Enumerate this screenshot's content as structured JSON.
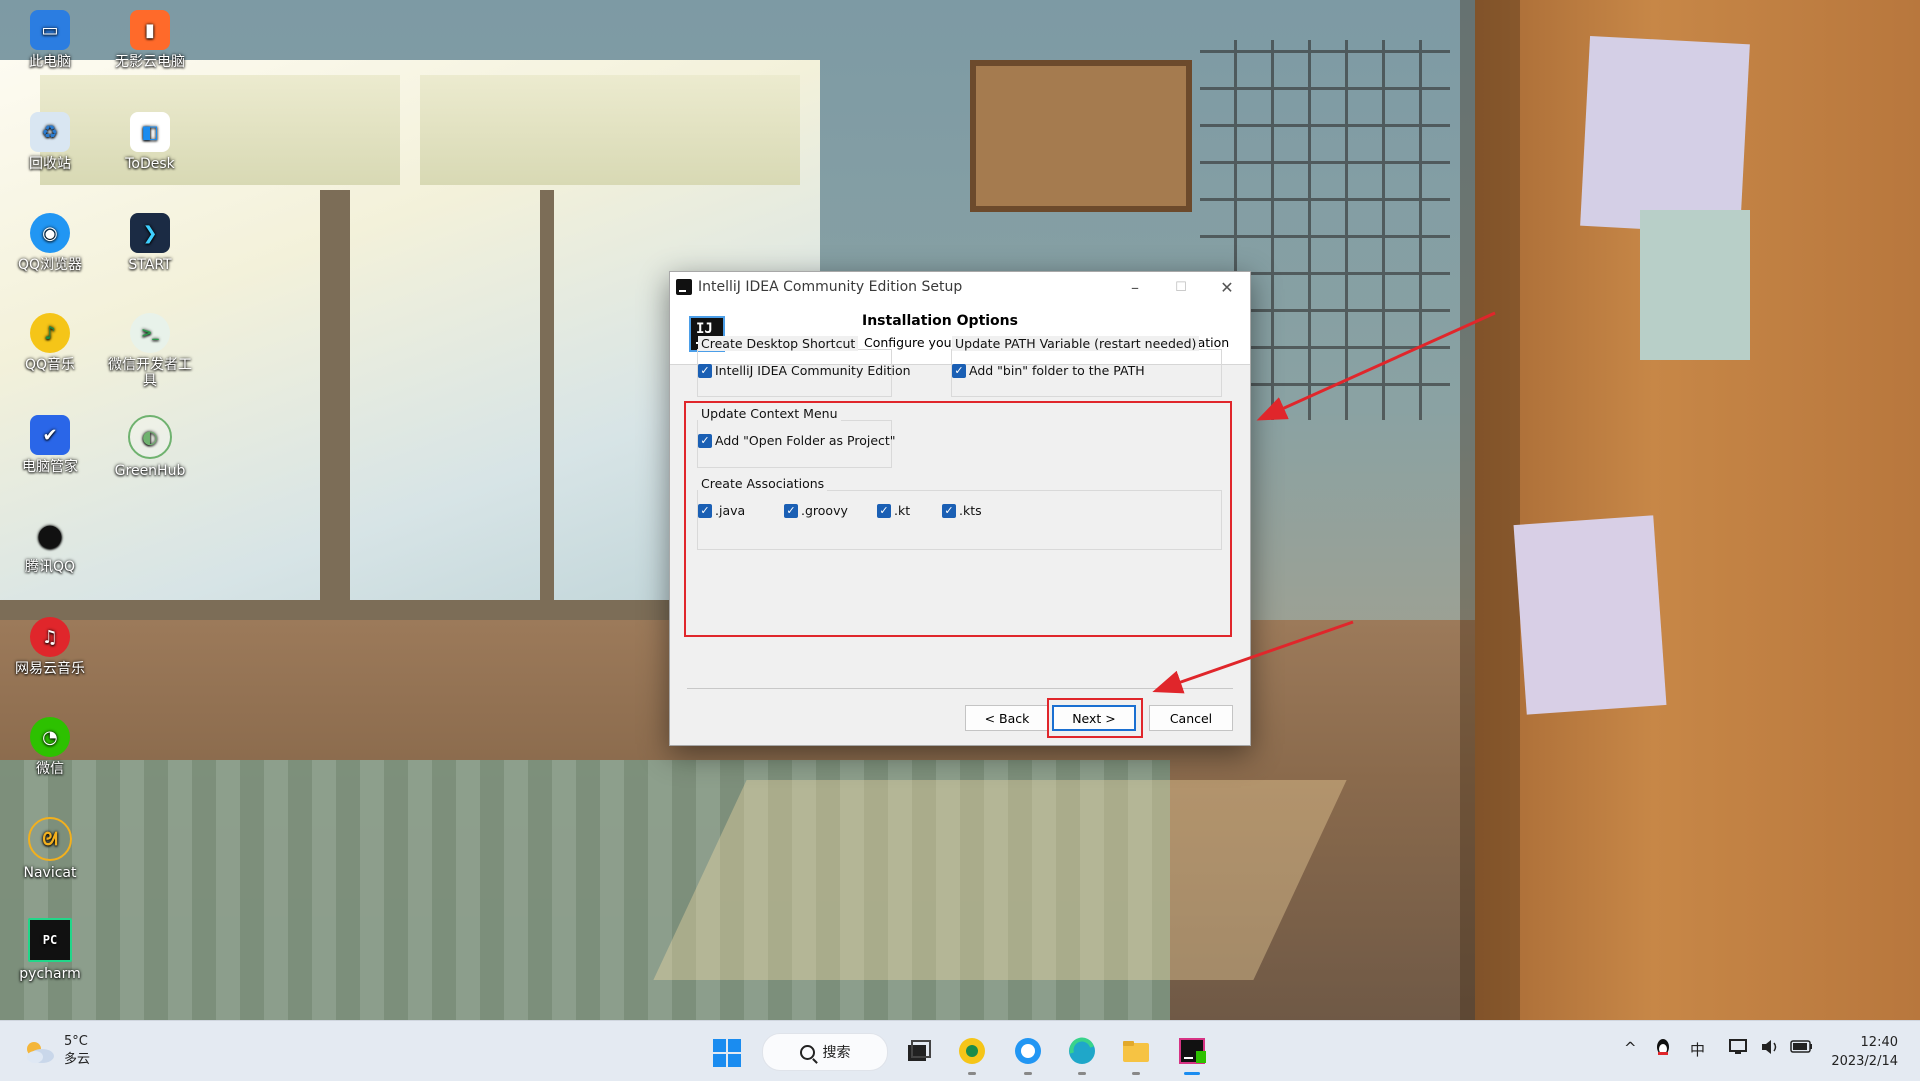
{
  "desktop_icons": [
    {
      "label": "此电脑",
      "icon": "computer-icon",
      "color": "#2b7de1"
    },
    {
      "label": "无影云电脑",
      "icon": "cloud-pc-icon",
      "color": "#ff6a2a"
    },
    {
      "label": "回收站",
      "icon": "recycle-bin-icon",
      "color": "#d9e6f2"
    },
    {
      "label": "ToDesk",
      "icon": "todesk-icon",
      "color": "#1a8cf0"
    },
    {
      "label": "QQ浏览器",
      "icon": "qq-browser-icon",
      "color": "#2196f3"
    },
    {
      "label": "START",
      "icon": "start-app-icon",
      "color": "#1b2b44"
    },
    {
      "label": "QQ音乐",
      "icon": "qq-music-icon",
      "color": "#f5c518"
    },
    {
      "label": "微信开发者工具",
      "icon": "wechat-devtools-icon",
      "color": "#e8f2ea"
    },
    {
      "label": "电脑管家",
      "icon": "pc-manager-icon",
      "color": "#2a66e8"
    },
    {
      "label": "GreenHub",
      "icon": "greenhub-icon",
      "color": "#6fb26f"
    },
    {
      "label": "腾讯QQ",
      "icon": "qq-icon",
      "color": "#111111"
    },
    {
      "label": "网易云音乐",
      "icon": "netease-music-icon",
      "color": "#e0262b"
    },
    {
      "label": "微信",
      "icon": "wechat-icon",
      "color": "#2dc100"
    },
    {
      "label": "Navicat",
      "icon": "navicat-icon",
      "color": "#f2b01e"
    },
    {
      "label": "pycharm",
      "icon": "pycharm-icon",
      "color": "#111111"
    }
  ],
  "dialog": {
    "title": "IntelliJ IDEA Community Edition Setup",
    "header_title": "Installation Options",
    "header_subtitle": "Configure your IntelliJ IDEA Community Edition installation",
    "header_icon_text": "IJ",
    "groups": {
      "desktop_shortcut": {
        "label": "Create Desktop Shortcut",
        "option": "IntelliJ IDEA Community Edition",
        "checked": true
      },
      "update_path": {
        "label": "Update PATH Variable (restart needed)",
        "option": "Add \"bin\" folder to the PATH",
        "checked": true
      },
      "context_menu": {
        "label": "Update Context Menu",
        "option": "Add \"Open Folder as Project\"",
        "checked": true
      },
      "associations": {
        "label": "Create Associations",
        "options": [
          ".java",
          ".groovy",
          ".kt",
          ".kts"
        ],
        "checked": [
          true,
          true,
          true,
          true
        ]
      }
    },
    "buttons": {
      "back": "< Back",
      "next": "Next >",
      "cancel": "Cancel"
    },
    "controls": {
      "minimize": "–",
      "maximize": "☐",
      "close": "✕"
    }
  },
  "annotation_color": "#e0262b",
  "taskbar": {
    "weather_temp": "5°C",
    "weather_desc": "多云",
    "search_label": "搜索",
    "tray": {
      "chevron": "^",
      "ime": "中"
    },
    "time": "12:40",
    "date": "2023/2/14",
    "accent": "#1a8cf0"
  }
}
